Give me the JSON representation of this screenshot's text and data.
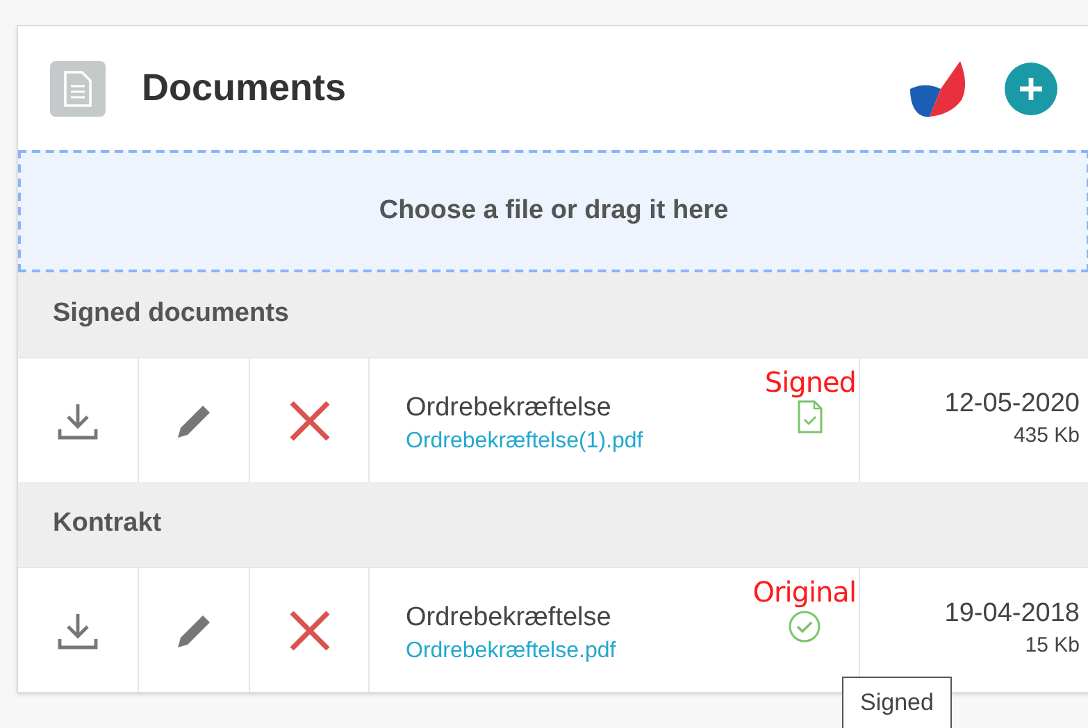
{
  "header": {
    "title": "Documents"
  },
  "dropzone": {
    "label": "Choose a file or drag it here"
  },
  "sections": [
    {
      "title": "Signed documents",
      "rows": [
        {
          "name": "Ordrebekræftelse",
          "file": "Ordrebekræftelse(1).pdf",
          "status": "Signed",
          "kind": "signed-file",
          "date": "12-05-2020",
          "size": "435 Kb"
        }
      ]
    },
    {
      "title": "Kontrakt",
      "rows": [
        {
          "name": "Ordrebekræftelse",
          "file": "Ordrebekræftelse.pdf",
          "status": "Original",
          "kind": "check-circle",
          "date": "19-04-2018",
          "size": "15 Kb"
        }
      ]
    }
  ],
  "tooltip": {
    "text": "Signed"
  }
}
